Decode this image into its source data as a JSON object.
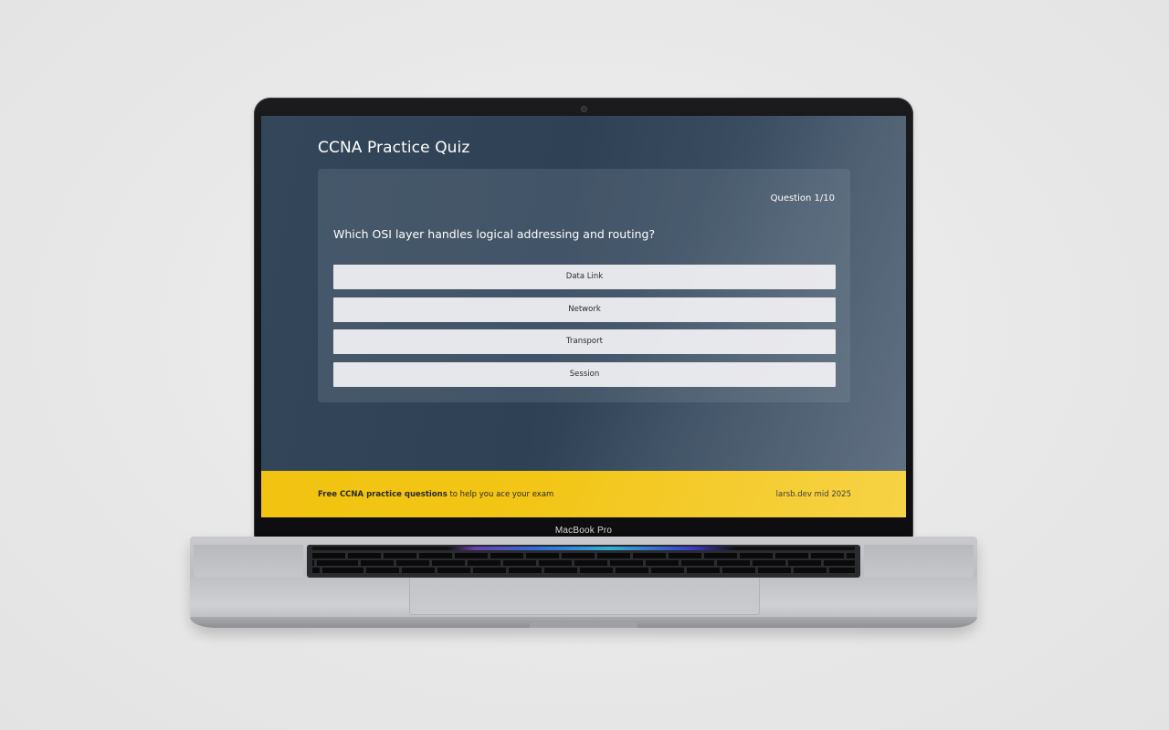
{
  "device": {
    "brand_label": "MacBook Pro"
  },
  "app": {
    "title": "CCNA Practice Quiz"
  },
  "quiz": {
    "counter": "Question 1/10",
    "question": "Which OSI layer handles logical addressing and routing?",
    "answers": [
      {
        "label": "Data Link"
      },
      {
        "label": "Network"
      },
      {
        "label": "Transport"
      },
      {
        "label": "Session"
      }
    ]
  },
  "footer": {
    "left_bold": "Free CCNA practice questions",
    "left_rest": " to help you ace your exam",
    "right": "larsb.dev mid 2025"
  },
  "colors": {
    "screen_background": "#33465a",
    "footer_background": "#f2c311",
    "answer_button": "#e6e7eb"
  }
}
